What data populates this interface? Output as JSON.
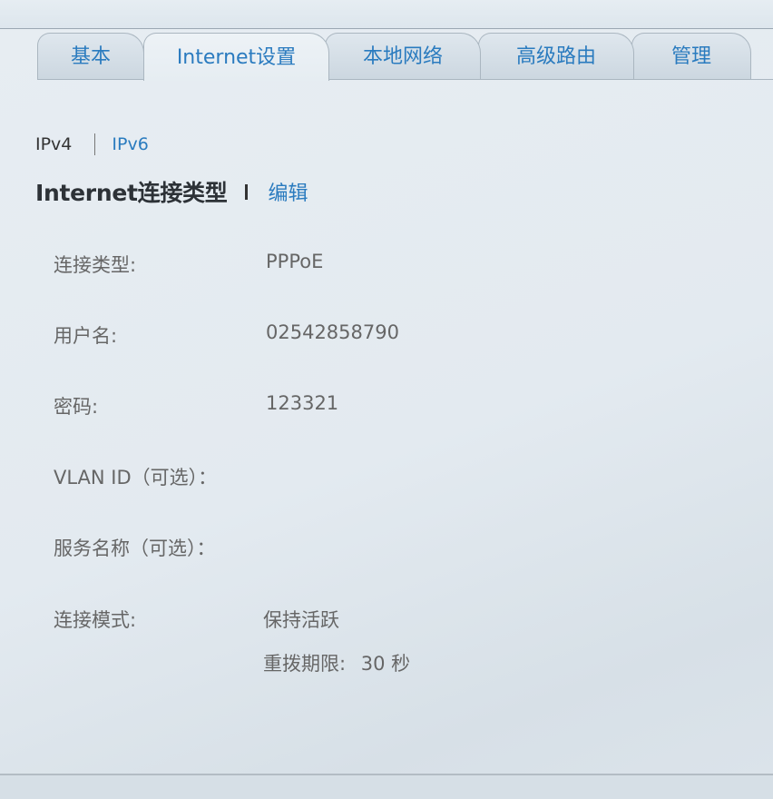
{
  "tabs": [
    {
      "label": "基本",
      "active": false
    },
    {
      "label": "Internet设置",
      "active": true
    },
    {
      "label": "本地网络",
      "active": false
    },
    {
      "label": "高级路由",
      "active": false
    },
    {
      "label": "管理",
      "active": false
    }
  ],
  "ip_version": {
    "ipv4": "IPv4",
    "ipv6": "IPv6",
    "selected": "IPv4"
  },
  "section": {
    "title": "Internet连接类型",
    "separator": "I",
    "edit_label": "编辑"
  },
  "fields": {
    "connection_type": {
      "label": "连接类型:",
      "value": "PPPoE"
    },
    "username": {
      "label": "用户名:",
      "value": "02542858790"
    },
    "password": {
      "label": "密码:",
      "value": "123321"
    },
    "vlan_id": {
      "label": "VLAN ID（可选）：",
      "value": ""
    },
    "service_name": {
      "label": "服务名称（可选）：",
      "value": ""
    },
    "connection_mode": {
      "label": "连接模式:",
      "value": "保持活跃",
      "redial_label": "重拨期限:",
      "redial_value": "30 秒"
    }
  },
  "colors": {
    "link": "#2a7bbf",
    "label": "#666666",
    "title": "#2d3237",
    "background": "#e4ebf1"
  }
}
